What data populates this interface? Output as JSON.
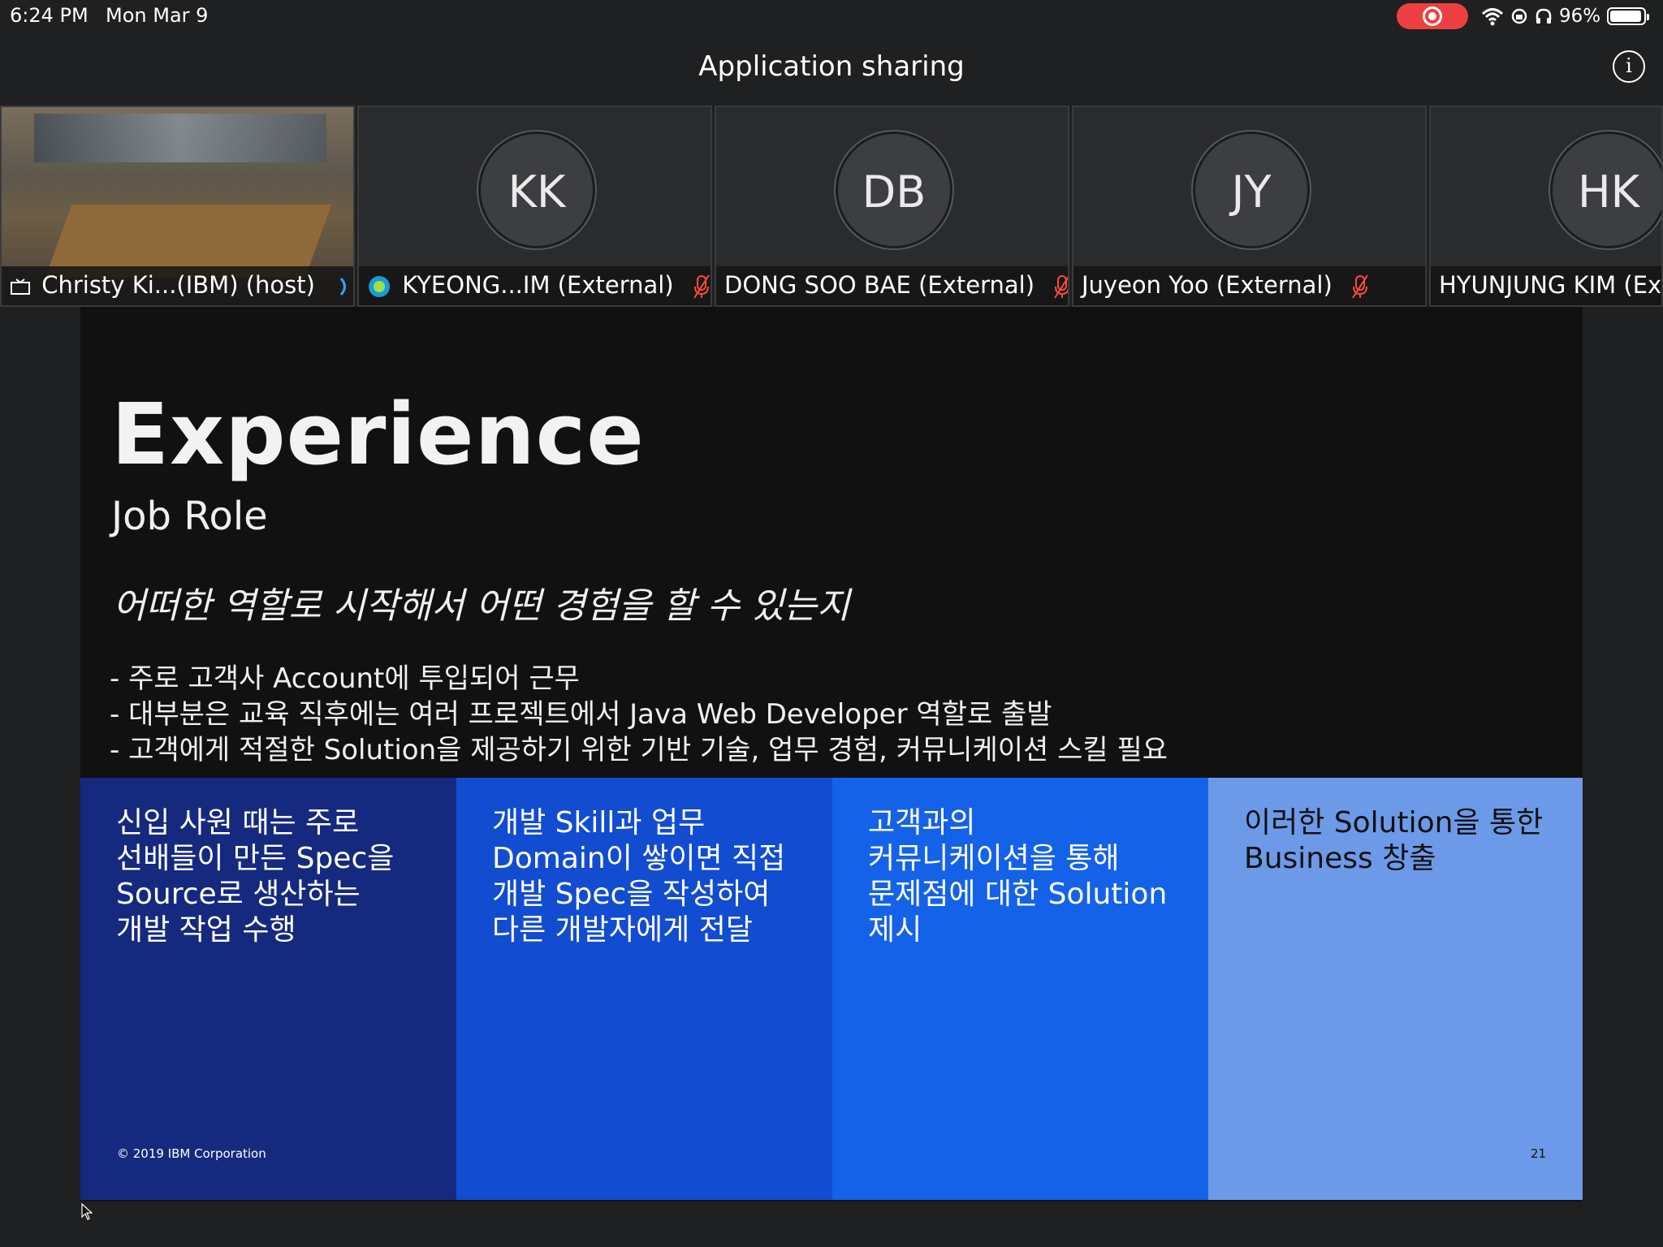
{
  "status_bar": {
    "time": "6:24 PM",
    "date": "Mon Mar 9",
    "battery": "96%",
    "recording_color": "#ee3f40"
  },
  "header": {
    "title": "Application sharing",
    "info_icon": "i"
  },
  "participants": [
    {
      "initials": "",
      "name": "Christy Ki...(IBM) (host)",
      "video": true
    },
    {
      "initials": "KK",
      "name": "KYEONG...IM (External)",
      "muted": true
    },
    {
      "initials": "DB",
      "name": "DONG SOO BAE (External)",
      "muted": true
    },
    {
      "initials": "JY",
      "name": "Juyeon Yoo (External)",
      "muted": true
    },
    {
      "initials": "HK",
      "name": "HYUNJUNG KIM (Ex",
      "muted": false
    }
  ],
  "slide": {
    "title": "Experience",
    "subtitle": "Job Role",
    "question": "어떠한 역할로 시작해서 어떤 경험을 할 수 있는지",
    "bullets": [
      "- 주로 고객사 Account에 투입되어 근무",
      "- 대부분은 교육 직후에는 여러 프로젝트에서 Java Web Developer 역할로 출발",
      "- 고객에게 적절한 Solution을 제공하기 위한 기반 기술, 업무 경험, 커뮤니케이션 스킬 필요"
    ],
    "boxes": [
      {
        "text": "신입 사원 때는 주로\n선배들이 만든 Spec을\nSource로 생산하는\n개발 작업 수행"
      },
      {
        "text": "개발 Skill과 업무\nDomain이 쌓이면 직접\n개발 Spec을 작성하여\n다른 개발자에게 전달"
      },
      {
        "text": "고객과의\n커뮤니케이션을 통해\n문제점에 대한 Solution\n제시"
      },
      {
        "text": "이러한 Solution을 통한\nBusiness 창출"
      }
    ],
    "copyright": "© 2019 IBM Corporation",
    "page_number": "21"
  }
}
